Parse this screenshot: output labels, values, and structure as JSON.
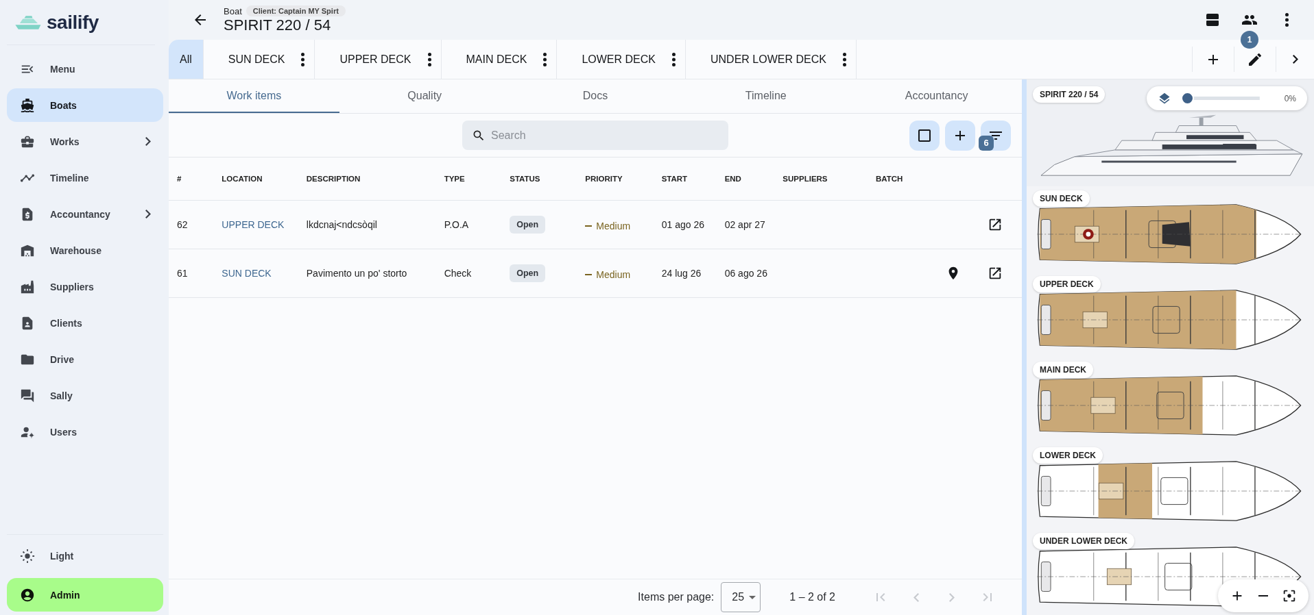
{
  "logo": {
    "text": "sailify"
  },
  "sidebar": {
    "items": [
      {
        "label": "Menu",
        "selected": false,
        "has_submenu": false
      },
      {
        "label": "Boats",
        "selected": true,
        "has_submenu": false
      },
      {
        "label": "Works",
        "selected": false,
        "has_submenu": true
      },
      {
        "label": "Timeline",
        "selected": false,
        "has_submenu": false
      },
      {
        "label": "Accountancy",
        "selected": false,
        "has_submenu": true
      },
      {
        "label": "Warehouse",
        "selected": false,
        "has_submenu": false
      },
      {
        "label": "Suppliers",
        "selected": false,
        "has_submenu": false
      },
      {
        "label": "Clients",
        "selected": false,
        "has_submenu": false
      },
      {
        "label": "Drive",
        "selected": false,
        "has_submenu": false
      },
      {
        "label": "Sally",
        "selected": false,
        "has_submenu": false
      },
      {
        "label": "Users",
        "selected": false,
        "has_submenu": false
      }
    ],
    "footer_items": [
      {
        "label": "Light",
        "kind": "theme"
      },
      {
        "label": "Admin",
        "kind": "user"
      }
    ]
  },
  "header": {
    "breadcrumb": "Boat",
    "client_chip": "Client: Captain MY Spirt",
    "title": "SPIRIT 220 / 54",
    "users_badge": "1"
  },
  "deck_tabs": [
    {
      "label": "All",
      "selected": true,
      "has_menu": false
    },
    {
      "label": "SUN DECK",
      "selected": false,
      "has_menu": true
    },
    {
      "label": "UPPER DECK",
      "selected": false,
      "has_menu": true
    },
    {
      "label": "MAIN DECK",
      "selected": false,
      "has_menu": true
    },
    {
      "label": "LOWER DECK",
      "selected": false,
      "has_menu": true
    },
    {
      "label": "UNDER LOWER DECK",
      "selected": false,
      "has_menu": true
    }
  ],
  "content_tabs": [
    {
      "label": "Work items",
      "selected": true
    },
    {
      "label": "Quality",
      "selected": false
    },
    {
      "label": "Docs",
      "selected": false
    },
    {
      "label": "Timeline",
      "selected": false
    },
    {
      "label": "Accountancy",
      "selected": false
    }
  ],
  "search": {
    "placeholder": "Search"
  },
  "toolbar": {
    "filter_badge": "6"
  },
  "table": {
    "columns": [
      "#",
      "LOCATION",
      "DESCRIPTION",
      "TYPE",
      "STATUS",
      "PRIORITY",
      "START",
      "END",
      "SUPPLIERS",
      "BATCH"
    ],
    "rows": [
      {
        "number": "62",
        "location": "UPPER DECK",
        "description": "lkdcnaj<ndcsòqil",
        "type": "P.O.A",
        "status": "Open",
        "priority": "Medium",
        "start": "01 ago 26",
        "end": "02 apr 27",
        "has_pin": false
      },
      {
        "number": "61",
        "location": "SUN DECK",
        "description": "Pavimento un po' storto",
        "type": "Check",
        "status": "Open",
        "priority": "Medium",
        "start": "24 lug 26",
        "end": "06 ago 26",
        "has_pin": true
      }
    ]
  },
  "pagination": {
    "label": "Items per page:",
    "page_size": "25",
    "range": "1 – 2 of 2",
    "nav": [
      {
        "disabled": true
      },
      {
        "disabled": true
      },
      {
        "disabled": true
      },
      {
        "disabled": true
      }
    ]
  },
  "plan_panel": {
    "title_chip": "SPIRIT 220 / 54",
    "layer_slider": {
      "level": 0,
      "reading": "0%"
    },
    "decks": [
      {
        "label": "SUN DECK",
        "marker": true
      },
      {
        "label": "UPPER DECK",
        "marker": false
      },
      {
        "label": "MAIN DECK",
        "marker": false
      },
      {
        "label": "LOWER DECK",
        "marker": false
      },
      {
        "label": "UNDER LOWER DECK",
        "marker": false
      }
    ]
  }
}
